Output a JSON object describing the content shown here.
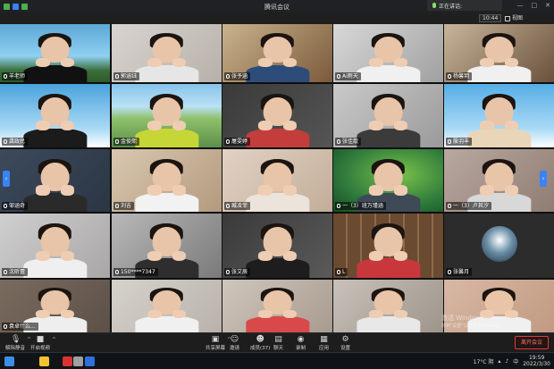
{
  "titlebar": {
    "title": "腾讯会议",
    "speaking_label": "正在讲话:",
    "controls": [
      "—",
      "□",
      "✕"
    ]
  },
  "subbar": {
    "elapsed": "10:44",
    "view_label": "视图"
  },
  "participants": [
    {
      "name": "羊老师",
      "bg": "#5ba7d6",
      "accent": "#3b6e3a",
      "shirt": "#111111",
      "active": true,
      "scene": "cartoon"
    },
    {
      "name": "郭涵钰",
      "bg": "#d9d4d0",
      "accent": "#b7b0aa",
      "shirt": "#e6e6e6"
    },
    {
      "name": "张予涵",
      "bg": "#c9b38b",
      "accent": "#7b5a3c",
      "shirt": "#2e4c7a"
    },
    {
      "name": "Ai雨天",
      "bg": "#d8d8d8",
      "accent": "#a0a0a0",
      "shirt": "#f0f0f0"
    },
    {
      "name": "杨馨玥",
      "bg": "#c8b59a",
      "accent": "#6a523d",
      "shirt": "#f0f0f0"
    },
    {
      "name": "龚政民",
      "bg": "#4aa3dd",
      "accent": "#2f7fc0",
      "shirt": "#1b1b1b",
      "scene": "sky"
    },
    {
      "name": "金俊熙",
      "bg": "#5b8f4a",
      "accent": "#8ec06a",
      "shirt": "#c6d636",
      "scene": "hills"
    },
    {
      "name": "屠雯婷",
      "bg": "#3a3a3a",
      "accent": "#555555",
      "shirt": "#c43d3d"
    },
    {
      "name": "张佳歆",
      "bg": "#c9c9c9",
      "accent": "#9a9a9a",
      "shirt": "#3b3b3b"
    },
    {
      "name": "殷羽丰",
      "bg": "#56aee6",
      "accent": "#3c8fd0",
      "shirt": "#e9d6b8",
      "scene": "sky"
    },
    {
      "name": "邹涵奇",
      "bg": "#3c4a5c",
      "accent": "#2b3644",
      "shirt": "#2a2a2a"
    },
    {
      "name": "刘吉",
      "bg": "#d9c7b0",
      "accent": "#b39a7e",
      "shirt": "#f2f2f2"
    },
    {
      "name": "臧凌菲",
      "bg": "#e2d2c4",
      "accent": "#c2ad98",
      "shirt": "#ece4da"
    },
    {
      "name": "一（3）班万瑾涵",
      "bg": "#2f7b3c",
      "accent": "#79c24a",
      "shirt": "#3e4a55",
      "scene": "leaf"
    },
    {
      "name": "一（3）卢其汐",
      "bg": "#b9a8a0",
      "accent": "#8f7d72",
      "shirt": "#d8d8d8"
    },
    {
      "name": "沈昕蕾",
      "bg": "#d0cfcf",
      "accent": "#a8a6a6",
      "shirt": "#efefef"
    },
    {
      "name": "150****7347",
      "bg": "#b8b8b8",
      "accent": "#7a7a7a",
      "shirt": "#2e2e2e"
    },
    {
      "name": "张艾辰",
      "bg": "#3a3a3a",
      "accent": "#5a5a5a",
      "shirt": "#1d1d1d"
    },
    {
      "name": "L",
      "bg": "#6b4a32",
      "accent": "#8d6a4a",
      "shirt": "#c8373c",
      "scene": "shelf"
    },
    {
      "name": "张馨月",
      "bg": "#2c2c2c",
      "accent": "#3c3c3c",
      "shirt": "#2c2c2c",
      "scene": "avatar"
    },
    {
      "name": "袁卓什么...",
      "bg": "#7a6b5e",
      "accent": "#5c5048",
      "shirt": "#eeeeee"
    },
    {
      "name": "",
      "bg": "#d6d2cc",
      "accent": "#b8b2aa",
      "shirt": "#f0f0f0"
    },
    {
      "name": "",
      "bg": "#cfc6bc",
      "accent": "#a89b8e",
      "shirt": "#d84a4a"
    },
    {
      "name": "",
      "bg": "#c9c2ba",
      "accent": "#9d948a",
      "shirt": "#e8e8e8"
    },
    {
      "name": "",
      "bg": "#d8b8a4",
      "accent": "#c19a82",
      "shirt": "#f0f0f0"
    }
  ],
  "toolbar": {
    "items": [
      {
        "label": "解除静音",
        "icon": "mic-muted-icon",
        "glyph": "🎙"
      },
      {
        "label": "开启视频",
        "icon": "camera-icon",
        "glyph": "■"
      },
      {
        "label": "共享屏幕",
        "icon": "share-screen-icon",
        "glyph": "▣"
      },
      {
        "label": "邀请",
        "icon": "invite-icon",
        "glyph": "☺"
      },
      {
        "label": "成员(37)",
        "icon": "members-icon",
        "glyph": "☻"
      },
      {
        "label": "聊天",
        "icon": "chat-icon",
        "glyph": "▤"
      },
      {
        "label": "录制",
        "icon": "record-icon",
        "glyph": "◉"
      },
      {
        "label": "应用",
        "icon": "apps-icon",
        "glyph": "▦"
      },
      {
        "label": "设置",
        "icon": "settings-icon",
        "glyph": "⚙"
      }
    ],
    "end_label": "离开会议"
  },
  "watermark": {
    "line1": "激活 Windows",
    "line2": "转到\"设置\"以激活 Windows。"
  },
  "taskbar": {
    "weather": "17°C 阴",
    "time": "19:59",
    "date": "2022/3/30",
    "apps": [
      {
        "icon": "windows-start-icon",
        "color": "#3b8fe8"
      },
      {
        "icon": "file-explorer-icon",
        "color": "#f2c230"
      },
      {
        "icon": "wps-icon",
        "color": "#d93232"
      },
      {
        "icon": "app-icon",
        "color": "#a0a0a0"
      },
      {
        "icon": "tencent-meeting-icon",
        "color": "#2e6fe0"
      }
    ]
  },
  "colors": {
    "active_outline": "#7bd34d",
    "end_button": "#e53935",
    "arrow_button": "#3b82f6"
  }
}
